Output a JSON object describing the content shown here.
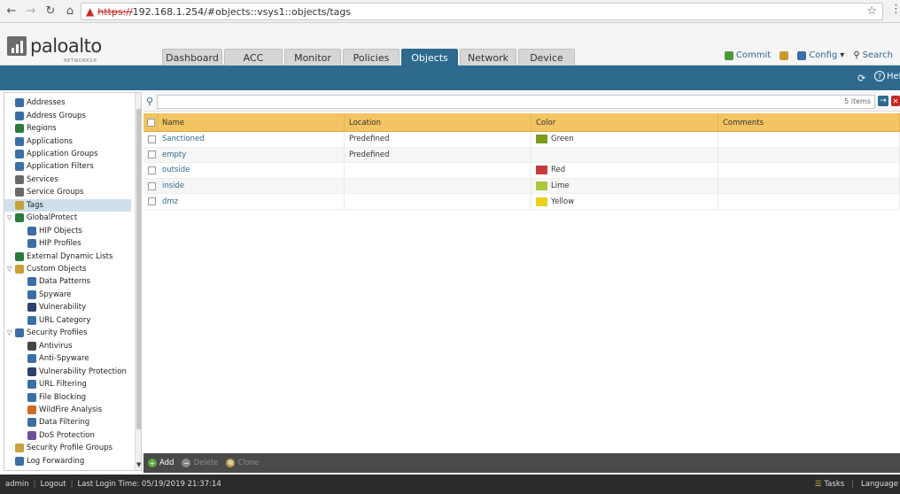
{
  "browser": {
    "url_prefix": "https://",
    "url_rest": "192.168.1.254/#objects::vsys1::objects/tags"
  },
  "brand": {
    "name": "paloalto",
    "sub": "NETWORKS®"
  },
  "tabs": [
    "Dashboard",
    "ACC",
    "Monitor",
    "Policies",
    "Objects",
    "Network",
    "Device"
  ],
  "active_tab": "Objects",
  "header_actions": {
    "commit": "Commit",
    "config": "Config",
    "search": "Search"
  },
  "band": {
    "help": "Help"
  },
  "sidebar": [
    {
      "label": "Addresses",
      "level": 1,
      "icon": "address-icon",
      "color": "#3a6ea5"
    },
    {
      "label": "Address Groups",
      "level": 1,
      "icon": "address-group-icon",
      "color": "#3a6ea5"
    },
    {
      "label": "Regions",
      "level": 1,
      "icon": "globe-icon",
      "color": "#2a7a3b"
    },
    {
      "label": "Applications",
      "level": 1,
      "icon": "applications-icon",
      "color": "#3a6ea5"
    },
    {
      "label": "Application Groups",
      "level": 1,
      "icon": "application-group-icon",
      "color": "#3a6ea5"
    },
    {
      "label": "Application Filters",
      "level": 1,
      "icon": "application-filter-icon",
      "color": "#3a6ea5"
    },
    {
      "label": "Services",
      "level": 1,
      "icon": "services-icon",
      "color": "#6a6a6a"
    },
    {
      "label": "Service Groups",
      "level": 1,
      "icon": "service-group-icon",
      "color": "#6a6a6a"
    },
    {
      "label": "Tags",
      "level": 1,
      "icon": "tag-icon",
      "color": "#c9a13a",
      "selected": true
    },
    {
      "label": "GlobalProtect",
      "level": 0,
      "icon": "globalprotect-icon",
      "color": "#2a7a3b",
      "caret": true
    },
    {
      "label": "HIP Objects",
      "level": 2,
      "icon": "hip-objects-icon",
      "color": "#3a6ea5"
    },
    {
      "label": "HIP Profiles",
      "level": 2,
      "icon": "hip-profiles-icon",
      "color": "#3a6ea5"
    },
    {
      "label": "External Dynamic Lists",
      "level": 1,
      "icon": "external-list-icon",
      "color": "#2a7a3b"
    },
    {
      "label": "Custom Objects",
      "level": 0,
      "icon": "custom-objects-icon",
      "color": "#c9a13a",
      "caret": true
    },
    {
      "label": "Data Patterns",
      "level": 2,
      "icon": "data-patterns-icon",
      "color": "#3a6ea5"
    },
    {
      "label": "Spyware",
      "level": 2,
      "icon": "spyware-icon",
      "color": "#3a6ea5"
    },
    {
      "label": "Vulnerability",
      "level": 2,
      "icon": "vulnerability-icon",
      "color": "#2f3f6f"
    },
    {
      "label": "URL Category",
      "level": 2,
      "icon": "url-category-icon",
      "color": "#3a6ea5"
    },
    {
      "label": "Security Profiles",
      "level": 0,
      "icon": "security-profiles-icon",
      "color": "#3a6ea5",
      "caret": true
    },
    {
      "label": "Antivirus",
      "level": 2,
      "icon": "antivirus-icon",
      "color": "#444444"
    },
    {
      "label": "Anti-Spyware",
      "level": 2,
      "icon": "anti-spyware-icon",
      "color": "#3a6ea5"
    },
    {
      "label": "Vulnerability Protection",
      "level": 2,
      "icon": "vulnerability-protection-icon",
      "color": "#2f3f6f"
    },
    {
      "label": "URL Filtering",
      "level": 2,
      "icon": "url-filtering-icon",
      "color": "#3a6ea5"
    },
    {
      "label": "File Blocking",
      "level": 2,
      "icon": "file-blocking-icon",
      "color": "#3a6ea5"
    },
    {
      "label": "WildFire Analysis",
      "level": 2,
      "icon": "wildfire-icon",
      "color": "#d06a2a"
    },
    {
      "label": "Data Filtering",
      "level": 2,
      "icon": "data-filtering-icon",
      "color": "#3a6ea5"
    },
    {
      "label": "DoS Protection",
      "level": 2,
      "icon": "dos-protection-icon",
      "color": "#6a4f9a"
    },
    {
      "label": "Security Profile Groups",
      "level": 1,
      "icon": "security-profile-groups-icon",
      "color": "#c9a13a"
    },
    {
      "label": "Log Forwarding",
      "level": 1,
      "icon": "log-forwarding-icon",
      "color": "#3a6ea5"
    }
  ],
  "filter": {
    "placeholder": "",
    "count": "5 items"
  },
  "columns": [
    "Name",
    "Location",
    "Color",
    "Comments"
  ],
  "rows": [
    {
      "name": "Sanctioned",
      "location": "Predefined",
      "color_name": "Green",
      "color_hex": "#7a9a1a",
      "comments": ""
    },
    {
      "name": "empty",
      "location": "Predefined",
      "color_name": "",
      "color_hex": "",
      "comments": ""
    },
    {
      "name": "outside",
      "location": "",
      "color_name": "Red",
      "color_hex": "#c8393b",
      "comments": ""
    },
    {
      "name": "inside",
      "location": "",
      "color_name": "Lime",
      "color_hex": "#a8c83a",
      "comments": ""
    },
    {
      "name": "dmz",
      "location": "",
      "color_name": "Yellow",
      "color_hex": "#e8d21c",
      "comments": ""
    }
  ],
  "bottom_actions": [
    {
      "label": "Add",
      "enabled": true
    },
    {
      "label": "Delete",
      "enabled": false
    },
    {
      "label": "Clone",
      "enabled": false
    }
  ],
  "status": {
    "user": "admin",
    "logout": "Logout",
    "last_login": "Last Login Time: 05/19/2019 21:37:14",
    "tasks": "Tasks",
    "language": "Language"
  }
}
